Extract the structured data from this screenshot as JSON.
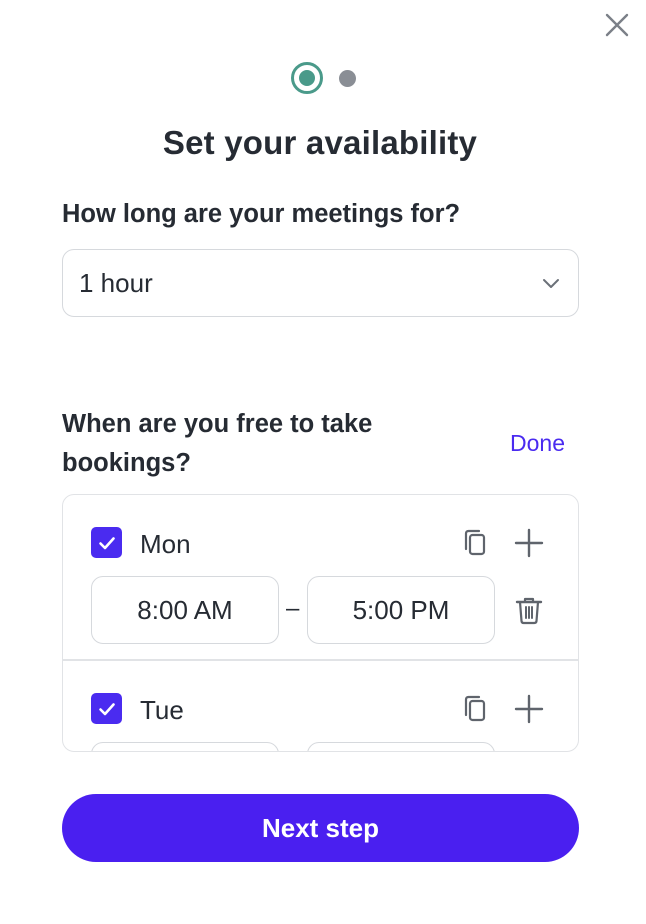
{
  "dialog": {
    "close_icon": "close-icon",
    "steps": {
      "total": 2,
      "current": 1
    },
    "title": "Set your availability"
  },
  "duration": {
    "question": "How long are your meetings for?",
    "selected": "1 hour",
    "icon": "chevron-down-icon"
  },
  "availability": {
    "question": "When are you free to take bookings?",
    "done_label": "Done",
    "days": [
      {
        "name": "Mon",
        "checked": true,
        "start": "8:00 AM",
        "end": "5:00 PM",
        "separator": "–"
      },
      {
        "name": "Tue",
        "checked": true,
        "start": "",
        "end": ""
      }
    ],
    "icons": {
      "copy": "copy-icon",
      "add": "plus-icon",
      "delete": "trash-icon",
      "check": "check-icon"
    }
  },
  "footer": {
    "next_label": "Next step"
  },
  "colors": {
    "accent": "#4a1ff0",
    "link": "#4a2bf0",
    "step_active": "#4a9a8a",
    "step_inactive": "#8a8e95",
    "text": "#262b33",
    "border": "#d6d9dd"
  }
}
